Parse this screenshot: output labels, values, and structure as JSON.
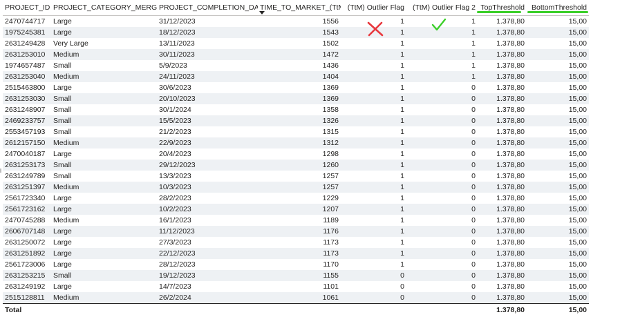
{
  "columns": [
    {
      "label": "PROJECT_ID",
      "align": "left"
    },
    {
      "label": "PROJECT_CATEGORY_MERGED",
      "align": "left"
    },
    {
      "label": "PROJECT_COMPLETION_DATE",
      "align": "left"
    },
    {
      "label": "TIME_TO_MARKET_(TtM)",
      "align": "left",
      "sorted": "descending"
    },
    {
      "label": "(TtM) Outlier Flag",
      "align": "right"
    },
    {
      "label": "(TtM) Outlier Flag 2",
      "align": "right"
    },
    {
      "label": "TopThreshold",
      "align": "right",
      "highlight": "green-underline"
    },
    {
      "label": "BottomThreshold",
      "align": "right",
      "highlight": "green-underline"
    }
  ],
  "rows": [
    [
      "2470744717",
      "Large",
      "31/12/2023",
      "1556",
      "1",
      "1",
      "1.378,80",
      "15,00"
    ],
    [
      "1975245381",
      "Large",
      "18/12/2023",
      "1543",
      "1",
      "1",
      "1.378,80",
      "15,00"
    ],
    [
      "2631249428",
      "Very Large",
      "13/11/2023",
      "1502",
      "1",
      "1",
      "1.378,80",
      "15,00"
    ],
    [
      "2631253010",
      "Medium",
      "30/11/2023",
      "1472",
      "1",
      "1",
      "1.378,80",
      "15,00"
    ],
    [
      "1974657487",
      "Small",
      "5/9/2023",
      "1436",
      "1",
      "1",
      "1.378,80",
      "15,00"
    ],
    [
      "2631253040",
      "Medium",
      "24/11/2023",
      "1404",
      "1",
      "1",
      "1.378,80",
      "15,00"
    ],
    [
      "2515463800",
      "Large",
      "30/6/2023",
      "1369",
      "1",
      "0",
      "1.378,80",
      "15,00"
    ],
    [
      "2631253030",
      "Small",
      "20/10/2023",
      "1369",
      "1",
      "0",
      "1.378,80",
      "15,00"
    ],
    [
      "2631248907",
      "Small",
      "30/1/2024",
      "1358",
      "1",
      "0",
      "1.378,80",
      "15,00"
    ],
    [
      "2469233757",
      "Small",
      "15/5/2023",
      "1326",
      "1",
      "0",
      "1.378,80",
      "15,00"
    ],
    [
      "2553457193",
      "Small",
      "21/2/2023",
      "1315",
      "1",
      "0",
      "1.378,80",
      "15,00"
    ],
    [
      "2612157150",
      "Medium",
      "22/9/2023",
      "1312",
      "1",
      "0",
      "1.378,80",
      "15,00"
    ],
    [
      "2470040187",
      "Large",
      "20/4/2023",
      "1298",
      "1",
      "0",
      "1.378,80",
      "15,00"
    ],
    [
      "2631253173",
      "Small",
      "29/12/2023",
      "1260",
      "1",
      "0",
      "1.378,80",
      "15,00"
    ],
    [
      "2631249789",
      "Small",
      "13/3/2023",
      "1257",
      "1",
      "0",
      "1.378,80",
      "15,00"
    ],
    [
      "2631251397",
      "Medium",
      "10/3/2023",
      "1257",
      "1",
      "0",
      "1.378,80",
      "15,00"
    ],
    [
      "2561723340",
      "Large",
      "28/2/2023",
      "1229",
      "1",
      "0",
      "1.378,80",
      "15,00"
    ],
    [
      "2561723162",
      "Large",
      "10/2/2023",
      "1207",
      "1",
      "0",
      "1.378,80",
      "15,00"
    ],
    [
      "2470745288",
      "Medium",
      "16/1/2023",
      "1189",
      "1",
      "0",
      "1.378,80",
      "15,00"
    ],
    [
      "2606707148",
      "Large",
      "11/12/2023",
      "1176",
      "1",
      "0",
      "1.378,80",
      "15,00"
    ],
    [
      "2631250072",
      "Large",
      "27/3/2023",
      "1173",
      "1",
      "0",
      "1.378,80",
      "15,00"
    ],
    [
      "2631251892",
      "Large",
      "22/12/2023",
      "1173",
      "1",
      "0",
      "1.378,80",
      "15,00"
    ],
    [
      "2561723006",
      "Large",
      "28/12/2023",
      "1170",
      "1",
      "0",
      "1.378,80",
      "15,00"
    ],
    [
      "2631253215",
      "Small",
      "19/12/2023",
      "1155",
      "0",
      "0",
      "1.378,80",
      "15,00"
    ],
    [
      "2631249192",
      "Large",
      "14/7/2023",
      "1101",
      "0",
      "0",
      "1.378,80",
      "15,00"
    ],
    [
      "2515128811",
      "Medium",
      "26/2/2024",
      "1061",
      "0",
      "0",
      "1.378,80",
      "15,00"
    ]
  ],
  "total": {
    "label": "Total",
    "top_threshold": "1.378,80",
    "bottom_threshold": "15,00"
  },
  "annotations": {
    "cross": {
      "icon": "red-x-mark",
      "color": "#e8383d"
    },
    "check": {
      "icon": "green-check-mark",
      "color": "#3bcf29"
    },
    "underline_color": "#3bcf29"
  },
  "colors": {
    "alt_row": "#eef1f4",
    "header_border": "#c8c6c4",
    "text": "#252423"
  }
}
